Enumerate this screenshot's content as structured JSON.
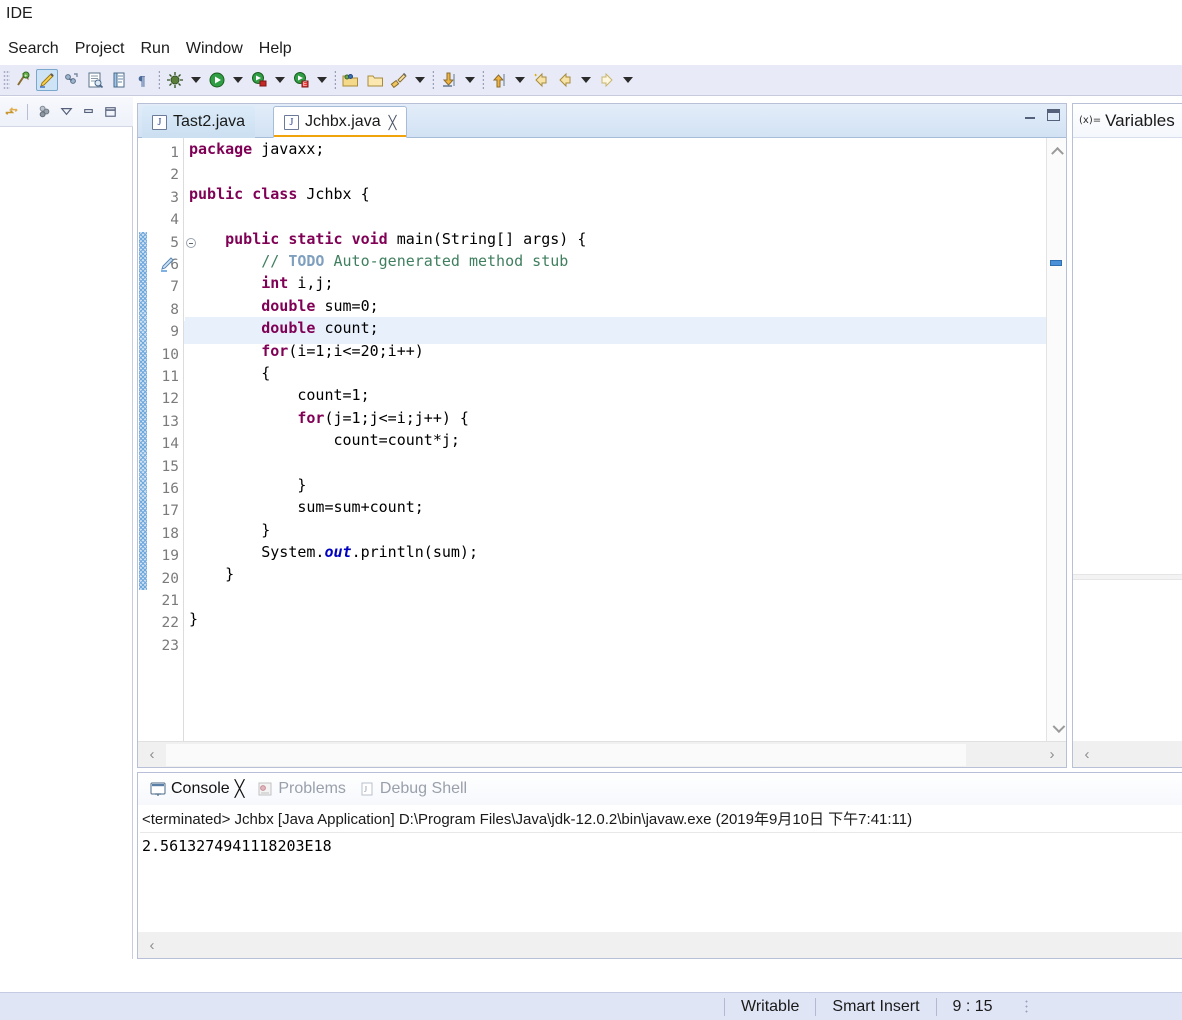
{
  "window": {
    "app_title": "IDE"
  },
  "menubar": {
    "items": [
      {
        "label": "Search"
      },
      {
        "label": "Project"
      },
      {
        "label": "Run"
      },
      {
        "label": "Window"
      },
      {
        "label": "Help"
      }
    ]
  },
  "toolbar": {
    "groups": [
      {
        "buttons": [
          {
            "name": "new-java-project-icon",
            "label": "New Java Project"
          },
          {
            "name": "highlight-pen-icon",
            "label": "Toggle Mark Occurrences",
            "active": true
          },
          {
            "name": "link-with-editor-icon",
            "label": "Link with Editor"
          },
          {
            "name": "open-type-icon",
            "label": "Open Type"
          },
          {
            "name": "open-task-icon",
            "label": "Open Task"
          },
          {
            "name": "pilcrow-icon",
            "label": "Show Whitespace Characters"
          }
        ]
      },
      {
        "buttons": [
          {
            "name": "debug-icon",
            "label": "Debug",
            "has_arrow": true
          },
          {
            "name": "run-icon",
            "label": "Run",
            "has_arrow": true
          },
          {
            "name": "run-external-tools-icon",
            "label": "External Tools",
            "has_arrow": true
          },
          {
            "name": "run-coverage-icon",
            "label": "Coverage",
            "has_arrow": true
          }
        ]
      },
      {
        "buttons": [
          {
            "name": "new-package-icon",
            "label": "New Package"
          },
          {
            "name": "new-folder-icon",
            "label": "New Folder"
          },
          {
            "name": "new-class-icon",
            "label": "New Java Class",
            "has_arrow": true
          }
        ]
      },
      {
        "buttons": [
          {
            "name": "step-into-icon",
            "label": "Next Annotation",
            "has_arrow": true
          }
        ]
      },
      {
        "buttons": [
          {
            "name": "step-return-icon",
            "label": "Previous Annotation",
            "has_arrow": true
          },
          {
            "name": "last-edit-location-icon",
            "label": "Last Edit Location"
          },
          {
            "name": "back-icon",
            "label": "Back",
            "has_arrow": true
          },
          {
            "name": "forward-icon",
            "label": "Forward",
            "has_arrow": true
          }
        ]
      }
    ]
  },
  "left_pane": {
    "toolbar_buttons": [
      {
        "name": "link-with-editor-icon",
        "label": "Link with Editor"
      },
      {
        "name": "view-menu-members-icon",
        "label": "View Members"
      },
      {
        "name": "view-menu-icon",
        "label": "View Menu"
      },
      {
        "name": "minimize-icon",
        "label": "Minimize"
      },
      {
        "name": "maximize-icon",
        "label": "Maximize"
      }
    ]
  },
  "editor": {
    "tabs": [
      {
        "label": "Tast2.java",
        "icon": "java-file-icon",
        "active": false,
        "closable": false
      },
      {
        "label": "Jchbx.java",
        "icon": "java-file-icon",
        "active": true,
        "closable": true,
        "close_glyph": "╳"
      }
    ],
    "corner_buttons": [
      {
        "name": "minimize-icon",
        "label": "Minimize"
      },
      {
        "name": "maximize-icon",
        "label": "Maximize"
      }
    ],
    "current_line": 9,
    "gutter_markers": {
      "fold_line": 5,
      "warning_line": 6
    },
    "scroll": {
      "up_glyph": "⌃",
      "down_glyph": "⌄",
      "left_glyph": "‹",
      "right_glyph": "›"
    },
    "lines": [
      {
        "n": 1,
        "tokens": [
          {
            "t": "package",
            "c": "kw"
          },
          {
            "t": " javaxx;",
            "c": "plain"
          }
        ]
      },
      {
        "n": 2,
        "tokens": []
      },
      {
        "n": 3,
        "tokens": [
          {
            "t": "public",
            "c": "kw"
          },
          {
            "t": " ",
            "c": "plain"
          },
          {
            "t": "class",
            "c": "kw"
          },
          {
            "t": " Jchbx {",
            "c": "plain"
          }
        ]
      },
      {
        "n": 4,
        "tokens": []
      },
      {
        "n": 5,
        "tokens": [
          {
            "t": "    ",
            "c": "plain"
          },
          {
            "t": "public",
            "c": "kw"
          },
          {
            "t": " ",
            "c": "plain"
          },
          {
            "t": "static",
            "c": "kw"
          },
          {
            "t": " ",
            "c": "plain"
          },
          {
            "t": "void",
            "c": "kw"
          },
          {
            "t": " main(String[] args) {",
            "c": "plain"
          }
        ]
      },
      {
        "n": 6,
        "tokens": [
          {
            "t": "        ",
            "c": "plain"
          },
          {
            "t": "// ",
            "c": "cmt"
          },
          {
            "t": "TODO",
            "c": "cmt-tag"
          },
          {
            "t": " Auto-generated method stub",
            "c": "cmt"
          }
        ]
      },
      {
        "n": 7,
        "tokens": [
          {
            "t": "        ",
            "c": "plain"
          },
          {
            "t": "int",
            "c": "kw"
          },
          {
            "t": " i,j;",
            "c": "plain"
          }
        ]
      },
      {
        "n": 8,
        "tokens": [
          {
            "t": "        ",
            "c": "plain"
          },
          {
            "t": "double",
            "c": "kw"
          },
          {
            "t": " sum=0;",
            "c": "plain"
          }
        ]
      },
      {
        "n": 9,
        "tokens": [
          {
            "t": "        ",
            "c": "plain"
          },
          {
            "t": "double",
            "c": "kw"
          },
          {
            "t": " count;",
            "c": "plain"
          }
        ]
      },
      {
        "n": 10,
        "tokens": [
          {
            "t": "        ",
            "c": "plain"
          },
          {
            "t": "for",
            "c": "kw"
          },
          {
            "t": "(i=1;i<=20;i++)",
            "c": "plain"
          }
        ]
      },
      {
        "n": 11,
        "tokens": [
          {
            "t": "        {",
            "c": "plain"
          }
        ]
      },
      {
        "n": 12,
        "tokens": [
          {
            "t": "            count=1;",
            "c": "plain"
          }
        ]
      },
      {
        "n": 13,
        "tokens": [
          {
            "t": "            ",
            "c": "plain"
          },
          {
            "t": "for",
            "c": "kw"
          },
          {
            "t": "(j=1;j<=i;j++) {",
            "c": "plain"
          }
        ]
      },
      {
        "n": 14,
        "tokens": [
          {
            "t": "                count=count*j;",
            "c": "plain"
          }
        ]
      },
      {
        "n": 15,
        "tokens": []
      },
      {
        "n": 16,
        "tokens": [
          {
            "t": "            }",
            "c": "plain"
          }
        ]
      },
      {
        "n": 17,
        "tokens": [
          {
            "t": "            sum=sum+count;",
            "c": "plain"
          }
        ]
      },
      {
        "n": 18,
        "tokens": [
          {
            "t": "        }",
            "c": "plain"
          }
        ]
      },
      {
        "n": 19,
        "tokens": [
          {
            "t": "        System.",
            "c": "plain"
          },
          {
            "t": "out",
            "c": "fld"
          },
          {
            "t": ".println(sum);",
            "c": "plain"
          }
        ]
      },
      {
        "n": 20,
        "tokens": [
          {
            "t": "    }",
            "c": "plain"
          }
        ]
      },
      {
        "n": 21,
        "tokens": []
      },
      {
        "n": 22,
        "tokens": [
          {
            "t": "}",
            "c": "plain"
          }
        ]
      },
      {
        "n": 23,
        "tokens": []
      }
    ]
  },
  "variables_view": {
    "tab_label": "Variables",
    "tab_icon_text": "(x)=",
    "scroll": {
      "left_glyph": "‹"
    }
  },
  "console_view": {
    "tabs": [
      {
        "label": "Console",
        "icon": "console-icon",
        "active": true,
        "close_glyph": "╳"
      },
      {
        "label": "Problems",
        "icon": "problems-icon",
        "active": false
      },
      {
        "label": "Debug Shell",
        "icon": "debug-shell-icon",
        "active": false
      }
    ],
    "launch_line": "<terminated> Jchbx [Java Application] D:\\Program Files\\Java\\jdk-12.0.2\\bin\\javaw.exe (2019年9月10日 下午7:41:11)",
    "output": "2.5613274941118203E18",
    "scroll": {
      "left_glyph": "‹"
    }
  },
  "statusbar": {
    "writable": "Writable",
    "insert_mode": "Smart Insert",
    "cursor_position": "9 : 15"
  },
  "colors": {
    "keyword": "#7f0055",
    "comment": "#3f7f5f",
    "comment_tag": "#7f9fbf",
    "field": "#0000c0",
    "current_line_highlight": "#e8f1fb",
    "toolbar_bg": "#e8ebf7",
    "statusbar_bg": "#e0e5f6",
    "tab_active_underline": "#f0a30a"
  }
}
